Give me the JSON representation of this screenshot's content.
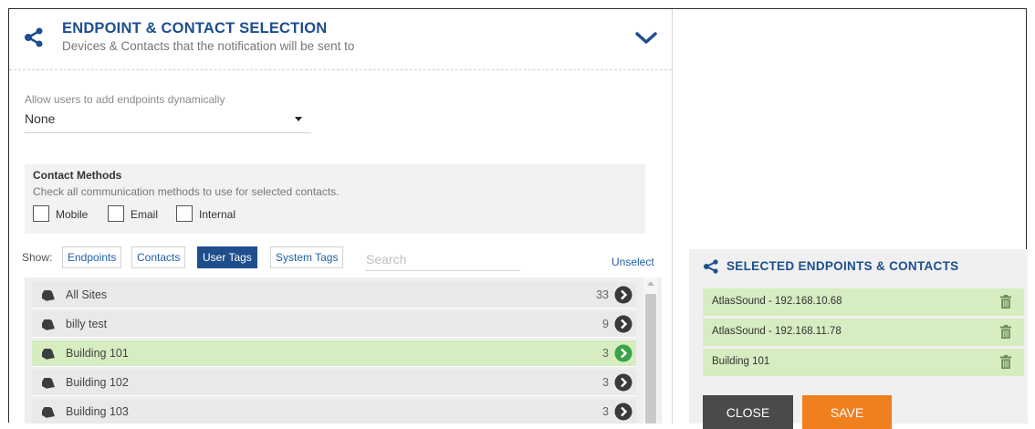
{
  "header": {
    "title": "ENDPOINT & CONTACT SELECTION",
    "subtitle": "Devices & Contacts that the notification will be sent to",
    "icon": "share-icon",
    "collapse_icon": "chevron-down-icon"
  },
  "dynamic_endpoints": {
    "label": "Allow users to add endpoints dynamically",
    "value": "None"
  },
  "contact_methods": {
    "title": "Contact Methods",
    "description": "Check all communication methods to use for selected contacts.",
    "options": [
      {
        "label": "Mobile",
        "checked": false
      },
      {
        "label": "Email",
        "checked": false
      },
      {
        "label": "Internal",
        "checked": false
      }
    ]
  },
  "filter": {
    "show_label": "Show:",
    "buttons": [
      {
        "label": "Endpoints",
        "active": false
      },
      {
        "label": "Contacts",
        "active": false
      },
      {
        "label": "User Tags",
        "active": true
      },
      {
        "label": "System Tags",
        "active": false
      }
    ],
    "search_placeholder": "Search",
    "unselect_label": "Unselect"
  },
  "tag_list": [
    {
      "label": "All Sites",
      "count": "33",
      "selected": false
    },
    {
      "label": "billy test",
      "count": "9",
      "selected": false
    },
    {
      "label": "Building 101",
      "count": "3",
      "selected": true
    },
    {
      "label": "Building 102",
      "count": "3",
      "selected": false
    },
    {
      "label": "Building 103",
      "count": "3",
      "selected": false
    }
  ],
  "selected_panel": {
    "title": "SELECTED ENDPOINTS & CONTACTS",
    "items": [
      {
        "label": "AtlasSound - 192.168.10.68"
      },
      {
        "label": "AtlasSound - 192.168.11.78"
      },
      {
        "label": "Building 101"
      }
    ],
    "close_label": "CLOSE",
    "save_label": "SAVE"
  },
  "colors": {
    "accent_blue": "#1d4e8f",
    "selected_green": "#d6ecc1",
    "save_orange": "#f07f1f",
    "close_dark": "#4a4a4a",
    "go_icon_green": "#3aa34a"
  }
}
